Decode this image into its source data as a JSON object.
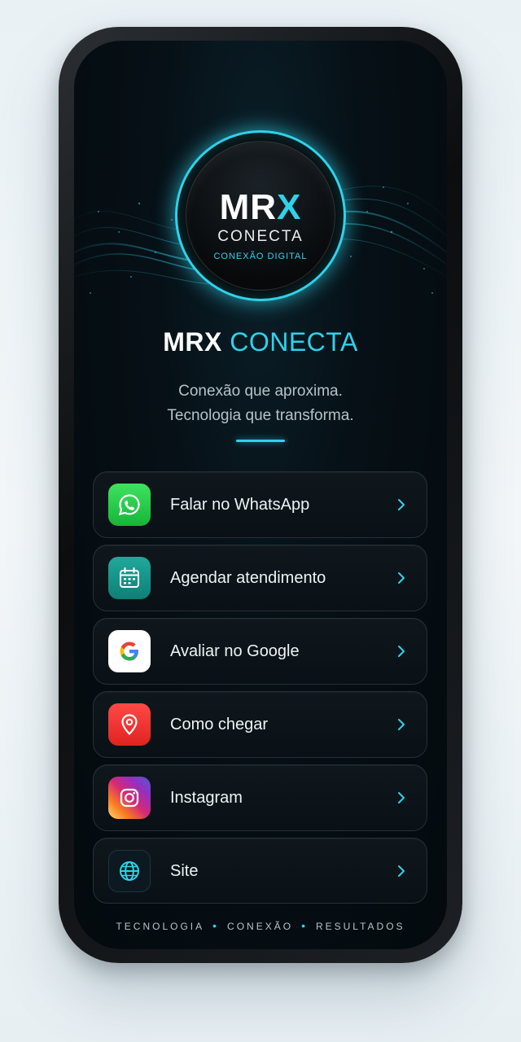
{
  "logo": {
    "mark_main": "MR",
    "mark_accent": "X",
    "wordmark": "CONECTA",
    "tagline": "CONEXÃO DIGITAL"
  },
  "header": {
    "title_main": "MRX",
    "title_accent": "CONECTA",
    "subtitle_line1": "Conexão que aproxima.",
    "subtitle_line2": "Tecnologia que transforma."
  },
  "menu": {
    "items": [
      {
        "label": "Falar no WhatsApp",
        "icon": "whatsapp-icon",
        "color": "#25D366"
      },
      {
        "label": "Agendar atendimento",
        "icon": "calendar-icon",
        "color": "#169A8E"
      },
      {
        "label": "Avaliar no Google",
        "icon": "google-icon",
        "color": "#FFFFFF"
      },
      {
        "label": "Como chegar",
        "icon": "location-pin-icon",
        "color": "#F0302C"
      },
      {
        "label": "Instagram",
        "icon": "instagram-icon",
        "color": "#D62976"
      },
      {
        "label": "Site",
        "icon": "globe-icon",
        "color": "#2FD2EA"
      }
    ]
  },
  "footer": {
    "word1": "TECNOLOGIA",
    "word2": "CONEXÃO",
    "word3": "RESULTADOS"
  },
  "colors": {
    "accent": "#2FD2EA",
    "background": "#040A0E",
    "card": "#0C141A"
  }
}
